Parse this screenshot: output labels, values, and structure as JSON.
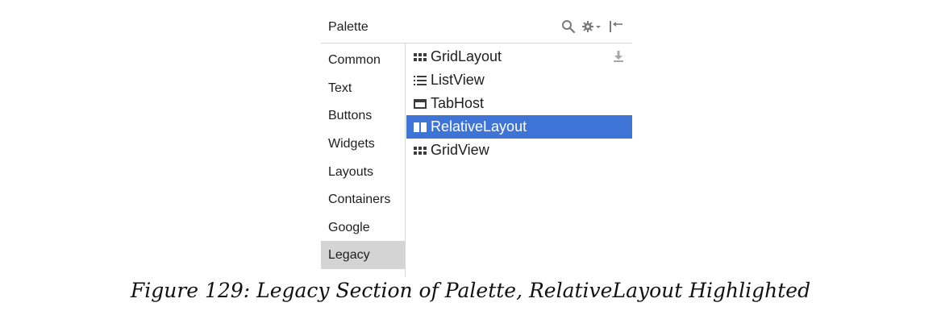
{
  "palette": {
    "title": "Palette",
    "categories": [
      "Common",
      "Text",
      "Buttons",
      "Widgets",
      "Layouts",
      "Containers",
      "Google",
      "Legacy"
    ],
    "selected_category": "Legacy",
    "items": [
      {
        "label": "GridLayout",
        "icon": "grid-icon"
      },
      {
        "label": "ListView",
        "icon": "list-icon"
      },
      {
        "label": "TabHost",
        "icon": "tab-icon"
      },
      {
        "label": "RelativeLayout",
        "icon": "relative-layout-icon"
      },
      {
        "label": "GridView",
        "icon": "grid-icon"
      }
    ],
    "selected_item": "RelativeLayout"
  },
  "caption": "Figure 129: Legacy Section of Palette, RelativeLayout Highlighted",
  "colors": {
    "selection": "#3e74d6",
    "category_selected": "#d4d4d4"
  }
}
